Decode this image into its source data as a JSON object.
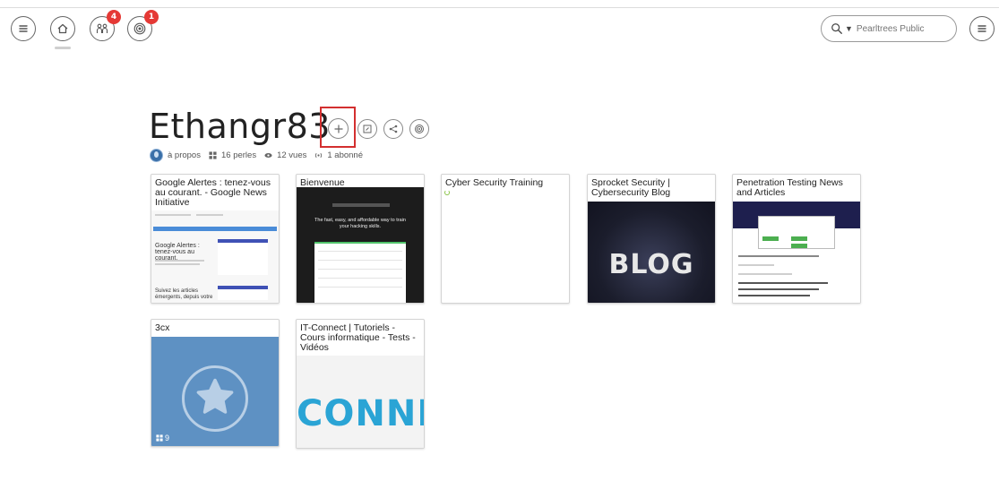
{
  "header_icons": {
    "menu": "menu-icon",
    "home": "home-icon",
    "team": "team-icon",
    "team_badge": "4",
    "notifications": "broadcast-icon",
    "notifications_badge": "1"
  },
  "search": {
    "placeholder": "Pearltrees Public",
    "scope_caret": "▼"
  },
  "profile": {
    "name": "Ethangr83",
    "about": "à propos",
    "pearls": "16 perles",
    "views": "12 vues",
    "subscribers": "1 abonné"
  },
  "cards": [
    {
      "title": "Google Alertes : tenez-vous au courant. - Google News Initiative",
      "thumb_heading": "Google Alertes : tenez-vous au courant.",
      "thumb_footer": "Suivez les articles émergents, depuis votre"
    },
    {
      "title": "Bienvenue",
      "thumb_text": "The fast, easy, and affordable way to train your hacking skills."
    },
    {
      "title": "Cyber Security Training"
    },
    {
      "title": "Sprocket Security | Cybersecurity Blog",
      "thumb_word": "BLOG"
    },
    {
      "title": "Penetration Testing News and Articles"
    },
    {
      "title": "3cx",
      "count": "9"
    },
    {
      "title": "IT-Connect | Tutoriels - Cours informatique - Tests - Vidéos",
      "thumb_word": "CONNEC"
    }
  ],
  "colors": {
    "badge": "#e53935",
    "highlight_border": "#d32f2f",
    "collection_bg": "#5e91c3",
    "connect_blue": "#2aa4d5"
  }
}
